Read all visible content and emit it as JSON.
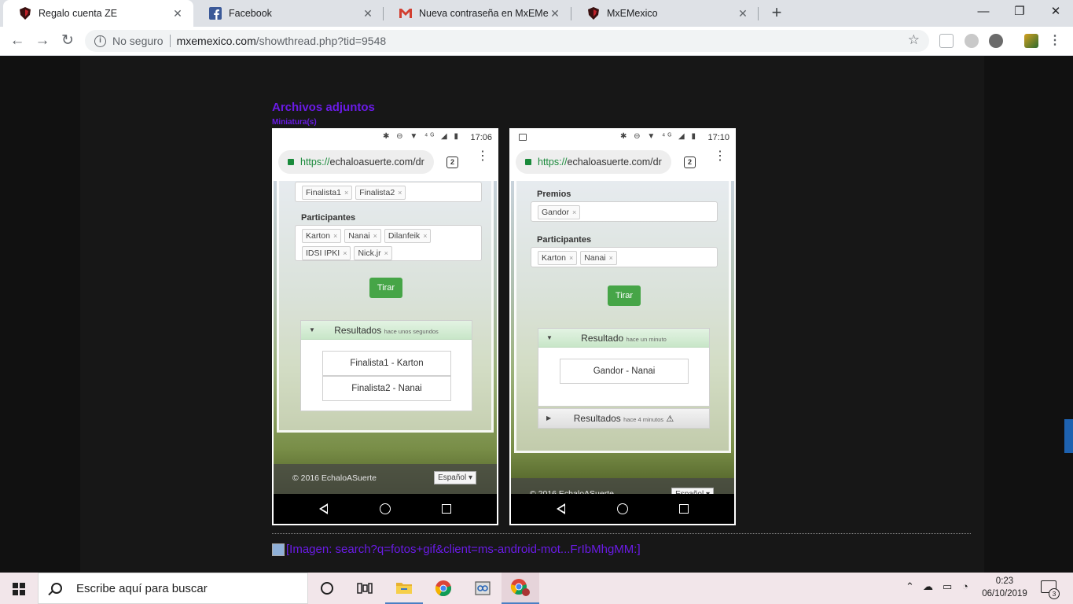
{
  "browser": {
    "tabs": [
      {
        "title": "Regalo cuenta ZE",
        "icon": "mxe-shield-icon",
        "active": true
      },
      {
        "title": "Facebook",
        "icon": "facebook-icon",
        "active": false
      },
      {
        "title": "Nueva contraseña en MxEMexico",
        "icon": "gmail-icon",
        "active": false
      },
      {
        "title": "MxEMexico",
        "icon": "mxe-shield-icon",
        "active": false
      }
    ],
    "close_glyph": "✕",
    "new_tab_glyph": "+",
    "window_controls": {
      "minimize": "—",
      "restore": "❐",
      "close": "✕"
    },
    "address": {
      "security_label": "No seguro",
      "host": "mxemexico.com",
      "path": "/showthread.php?tid=9548"
    }
  },
  "page": {
    "attachments_title": "Archivos adjuntos",
    "thumbnails_label": "Miniatura(s)",
    "broken_image_text": "[Imagen: search?q=fotos+gif&client=ms-android-mot...FrIbMhgMM:]",
    "accent_color": "#6a1be6"
  },
  "phones": [
    {
      "status_time": "17:06",
      "status_icons": "✱ ⊖ ▼ ⁴ᴳ ◢ ▮",
      "url_scheme": "https://",
      "url_host": "echaloasuerte.com/dr",
      "tab_count": "2",
      "top_chips": [
        "Finalista1",
        "Finalista2"
      ],
      "participants_label": "Participantes",
      "participant_chips_row1": [
        "Karton",
        "Nanai",
        "Dilanfeik"
      ],
      "participant_chips_row2": [
        "IDSI IPKI",
        "Nick.jr"
      ],
      "draw_button": "Tirar",
      "results_title": "Resultados",
      "results_time": "hace unos segundos",
      "results": [
        "Finalista1 - Karton",
        "Finalista2 - Nanai"
      ],
      "footer_copyright": "© 2016 EchaloASuerte",
      "footer_language": "Español ▾"
    },
    {
      "status_time": "17:10",
      "status_icons": "✱ ⊖ ▼ ⁴ᴳ ◢ ▮",
      "url_scheme": "https://",
      "url_host": "echaloasuerte.com/dr",
      "tab_count": "2",
      "prizes_label": "Premios",
      "prize_chips": [
        "Gandor"
      ],
      "participants_label": "Participantes",
      "participant_chips": [
        "Karton",
        "Nanai"
      ],
      "draw_button": "Tirar",
      "result_title": "Resultado",
      "result_time": "hace un minuto",
      "results": [
        "Gandor - Nanai"
      ],
      "older_title": "Resultados",
      "older_time": "hace 4 minutos",
      "footer_copyright": "© 2016 EchaloASuerte",
      "footer_language": "Español ▾"
    }
  ],
  "taskbar": {
    "search_placeholder": "Escribe aquí para buscar",
    "time": "0:23",
    "date": "06/10/2019",
    "notification_count": "3",
    "pinned": [
      "cortana-icon",
      "task-view-icon",
      "file-explorer-icon",
      "chrome-icon",
      "snipping-tool-icon",
      "chrome-active-icon"
    ]
  }
}
